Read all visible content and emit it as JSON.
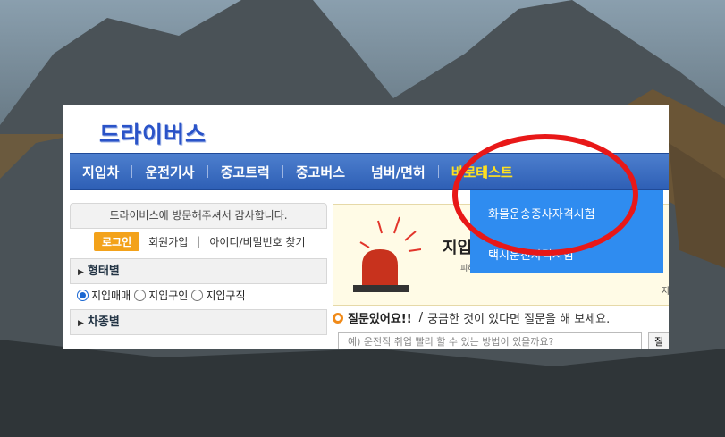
{
  "site": {
    "logo": "드라이버스"
  },
  "nav": {
    "items": [
      "지입차",
      "운전기사",
      "중고트럭",
      "중고버스",
      "넘버/면허",
      "바로테스트"
    ],
    "active_index": 5
  },
  "dropdown": {
    "items": [
      "화물운송종사자격시험",
      "택시운전자격시험"
    ]
  },
  "welcome": "드라이버스에 방문해주셔서 감사합니다.",
  "login": {
    "button": "로그인",
    "join": "회원가입",
    "find": "아이디/비밀번호 찾기",
    "sep": "|"
  },
  "filter_type": {
    "title": "형태별",
    "options": [
      "지입매매",
      "지입구인",
      "지입구직"
    ],
    "selected_index": 0
  },
  "filter_vehicle": {
    "title": "차종별"
  },
  "notice": {
    "title": "지입",
    "subtitle": "피해",
    "corner": "지"
  },
  "question": {
    "title": "질문있어요!!",
    "slash": "/",
    "desc": "궁금한 것이 있다면 질문을 해 보세요.",
    "placeholder": "예) 운전직 취업 빨리 할 수 있는 방법이 있을까요?",
    "button": "질"
  },
  "colors": {
    "nav_active": "#ffe01f",
    "dropdown_bg": "#2f8cf0",
    "highlight_circle": "#e81818",
    "login_button": "#f3a21a"
  }
}
